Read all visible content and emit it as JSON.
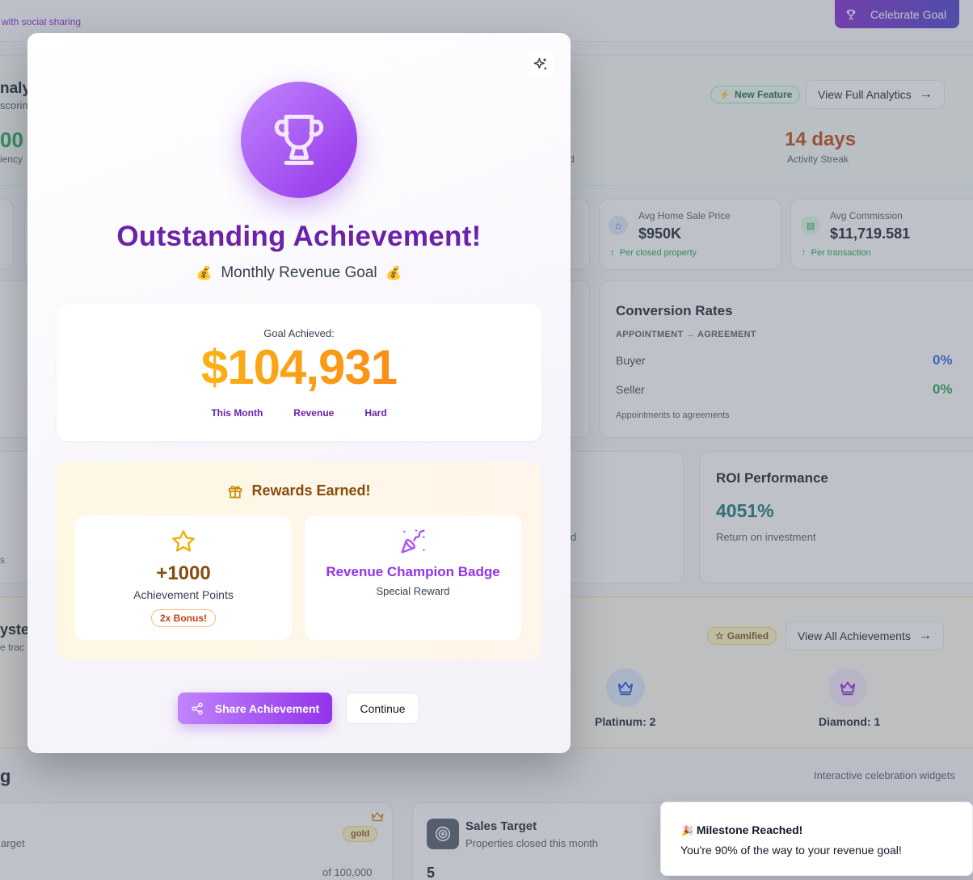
{
  "header": {
    "subtitle_fragment": "with social sharing",
    "celebrate_label": "Celebrate Goal"
  },
  "analytics": {
    "title_fragment": "nalyt",
    "sub_fragment": "scorin",
    "value_fragment": "00",
    "value_label_fragment": "iency",
    "badge": "New Feature",
    "view_label": "View Full Analytics",
    "hidden_fragment": "d",
    "streak_value": "14 days",
    "streak_label": "Activity Streak"
  },
  "stats": [
    {
      "label": "Avg Home Sale Price",
      "value": "$950K",
      "note": "Per closed property",
      "icon": "home-icon"
    },
    {
      "label": "Avg Commission",
      "value": "$11,719.581",
      "note": "Per transaction",
      "icon": "clipboard-icon"
    }
  ],
  "conversion": {
    "title": "Conversion Rates",
    "subtitle": "APPOINTMENT → AGREEMENT",
    "rows": [
      {
        "label": "Buyer",
        "value": "0%",
        "color": "#2563eb"
      },
      {
        "label": "Seller",
        "value": "0%",
        "color": "#16a34a"
      }
    ],
    "footnote": "Appointments to agreements"
  },
  "roi": {
    "title": "ROI Performance",
    "value": "4051%",
    "label": "Return on investment",
    "left_fragment": "d",
    "far_left_fragment": "s"
  },
  "achievements": {
    "title_fragment": "ysten",
    "sub_fragment": "e trac",
    "badge": "Gamified",
    "view_label": "View All Achievements",
    "tiers": [
      {
        "label": "Platinum: 2",
        "color": "#1d4ed8",
        "bg": "#dbeafe"
      },
      {
        "label": "Diamond: 1",
        "color": "#7e22ce",
        "bg": "#f3e8ff"
      }
    ]
  },
  "widgets": {
    "heading_fragment": "g",
    "caption": "Interactive celebration widgets",
    "card1": {
      "label_fragment": "arget",
      "badge": "gold",
      "footer": "of 100,000"
    },
    "card2": {
      "title": "Sales Target",
      "subtitle": "Properties closed this month",
      "value": "5"
    }
  },
  "modal": {
    "title": "Outstanding Achievement!",
    "subtitle_emoji": "💰",
    "subtitle": "Monthly Revenue Goal",
    "goal_label": "Goal Achieved:",
    "goal_value": "$104,931",
    "tags": [
      "This Month",
      "Revenue",
      "Hard"
    ],
    "rewards_title": "Rewards Earned!",
    "reward_points": {
      "value": "+1000",
      "label": "Achievement Points",
      "bonus": "2x Bonus!"
    },
    "reward_badge": {
      "title": "Revenue Champion Badge",
      "label": "Special Reward"
    },
    "share_label": "Share Achievement",
    "continue_label": "Continue"
  },
  "toast": {
    "emoji": "🎉",
    "title": "Milestone Reached!",
    "message": "You're 90% of the way to your revenue goal!"
  }
}
